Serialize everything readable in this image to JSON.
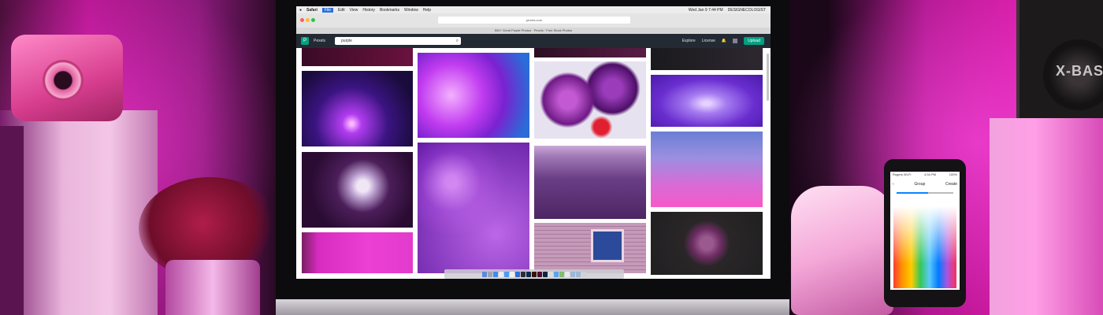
{
  "scene": {
    "speaker_brand": "X-BAS"
  },
  "menubar": {
    "apple": "",
    "app": "Safari",
    "items": [
      "File",
      "Edit",
      "View",
      "History",
      "Bookmarks",
      "Window",
      "Help"
    ],
    "active_index": 0,
    "clock": "Wed Jan 9  7:44 PM",
    "user": "DESIGNECOLOGIST"
  },
  "browser": {
    "address": "pexels.com",
    "tab_title": "500+ Great Purple Photos · Pexels · Free Stock Photos"
  },
  "site": {
    "brand": "Pexels",
    "search_value": "purple",
    "nav": [
      "Explore",
      "License"
    ],
    "upload_label": "Upload",
    "accent": "#05a081"
  },
  "phone": {
    "carrier": "Rogers Wi-Fi",
    "time": "4:34 PM",
    "battery": "100%",
    "title": "Group",
    "action": "Create",
    "slider_value": 0.55
  }
}
